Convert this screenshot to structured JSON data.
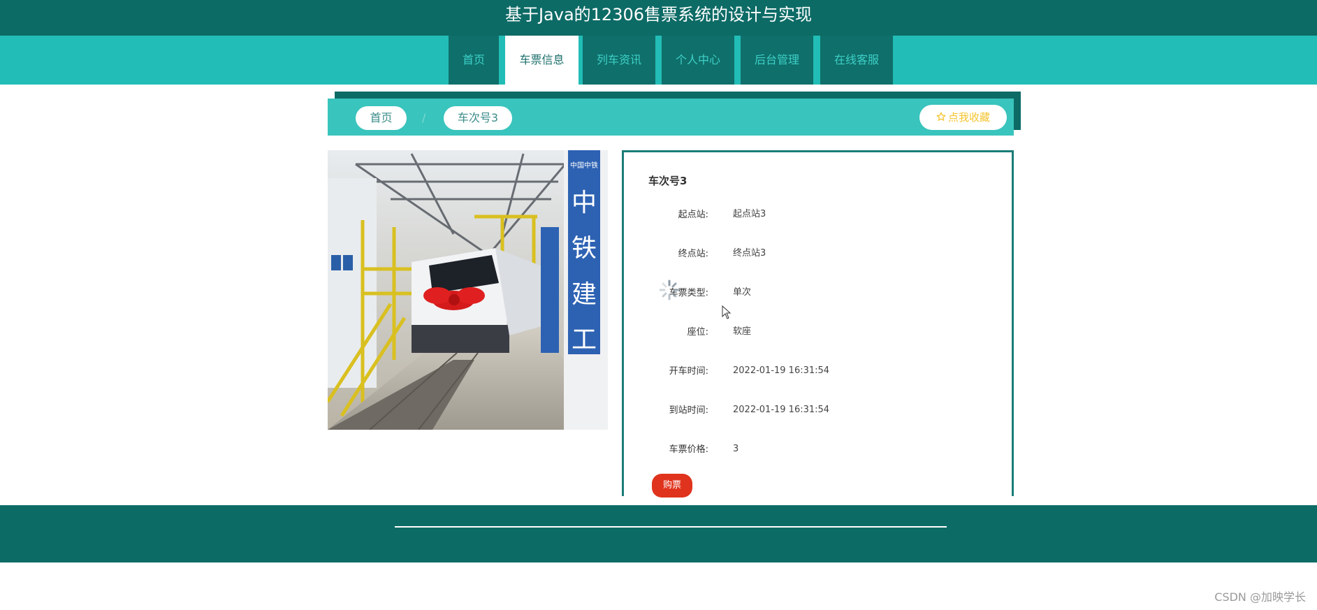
{
  "site": {
    "title": "基于Java的12306售票系统的设计与实现"
  },
  "nav": {
    "items": [
      {
        "label": "首页"
      },
      {
        "label": "车票信息",
        "active": true
      },
      {
        "label": "列车资讯"
      },
      {
        "label": "个人中心"
      },
      {
        "label": "后台管理"
      },
      {
        "label": "在线客服"
      }
    ]
  },
  "breadcrumb": {
    "home": "首页",
    "separator": "/",
    "current": "车次号3"
  },
  "favorite": {
    "label": "点我收藏",
    "icon": "star-outline-icon"
  },
  "ticket": {
    "title": "车次号3",
    "fields": [
      {
        "label": "起点站:",
        "value": "起点站3"
      },
      {
        "label": "终点站:",
        "value": "终点站3"
      },
      {
        "label": "车票类型:",
        "value": "单次"
      },
      {
        "label": "座位:",
        "value": "软座"
      },
      {
        "label": "开车时间:",
        "value": "2022-01-19 16:31:54"
      },
      {
        "label": "到站时间:",
        "value": "2022-01-19 16:31:54"
      },
      {
        "label": "车票价格:",
        "value": "3"
      }
    ],
    "buy_label": "购票"
  },
  "image": {
    "sign_chars": [
      "中",
      "铁",
      "建",
      "工"
    ],
    "logo_text": "中国中铁"
  },
  "watermark": "CSDN @加映学长",
  "colors": {
    "primary_dark": "#0d6b66",
    "primary": "#22bdb6",
    "accent_red": "#e0331d",
    "star": "#f4c430"
  }
}
